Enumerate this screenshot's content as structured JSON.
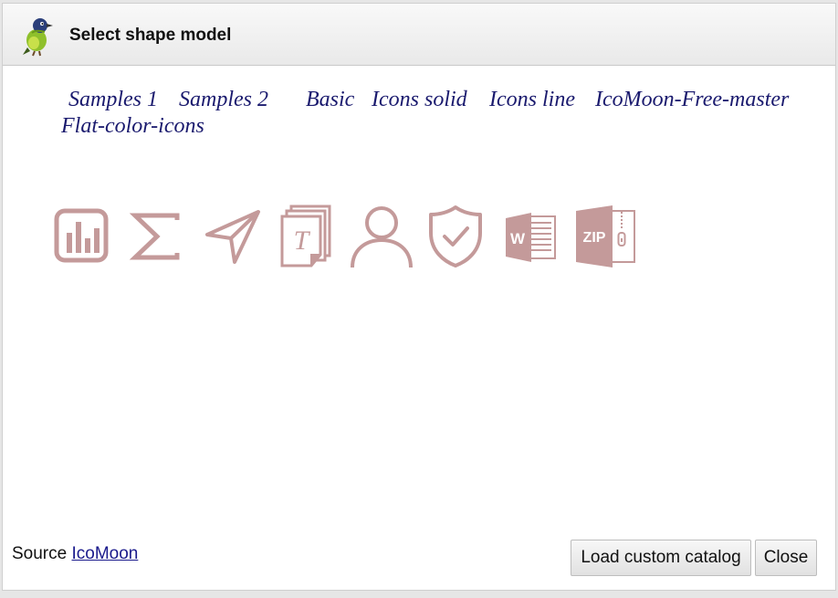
{
  "dialog": {
    "title": "Select shape model"
  },
  "tabs": [
    {
      "label": "Samples 1"
    },
    {
      "label": "Samples 2"
    },
    {
      "label": "Basic"
    },
    {
      "label": "Icons solid"
    },
    {
      "label": "Icons line"
    },
    {
      "label": "IcoMoon-Free-master"
    },
    {
      "label": "Flat-color-icons"
    }
  ],
  "icons": [
    {
      "name": "stats-bars-icon"
    },
    {
      "name": "sigma-icon"
    },
    {
      "name": "paper-plane-icon"
    },
    {
      "name": "text-document-icon"
    },
    {
      "name": "user-icon"
    },
    {
      "name": "shield-check-icon"
    },
    {
      "name": "word-file-icon"
    },
    {
      "name": "zip-file-icon"
    }
  ],
  "icon_color": "#c49a9a",
  "footer": {
    "source_label": "Source",
    "source_link": "IcoMoon",
    "load_button": "Load custom catalog",
    "close_button": "Close"
  }
}
